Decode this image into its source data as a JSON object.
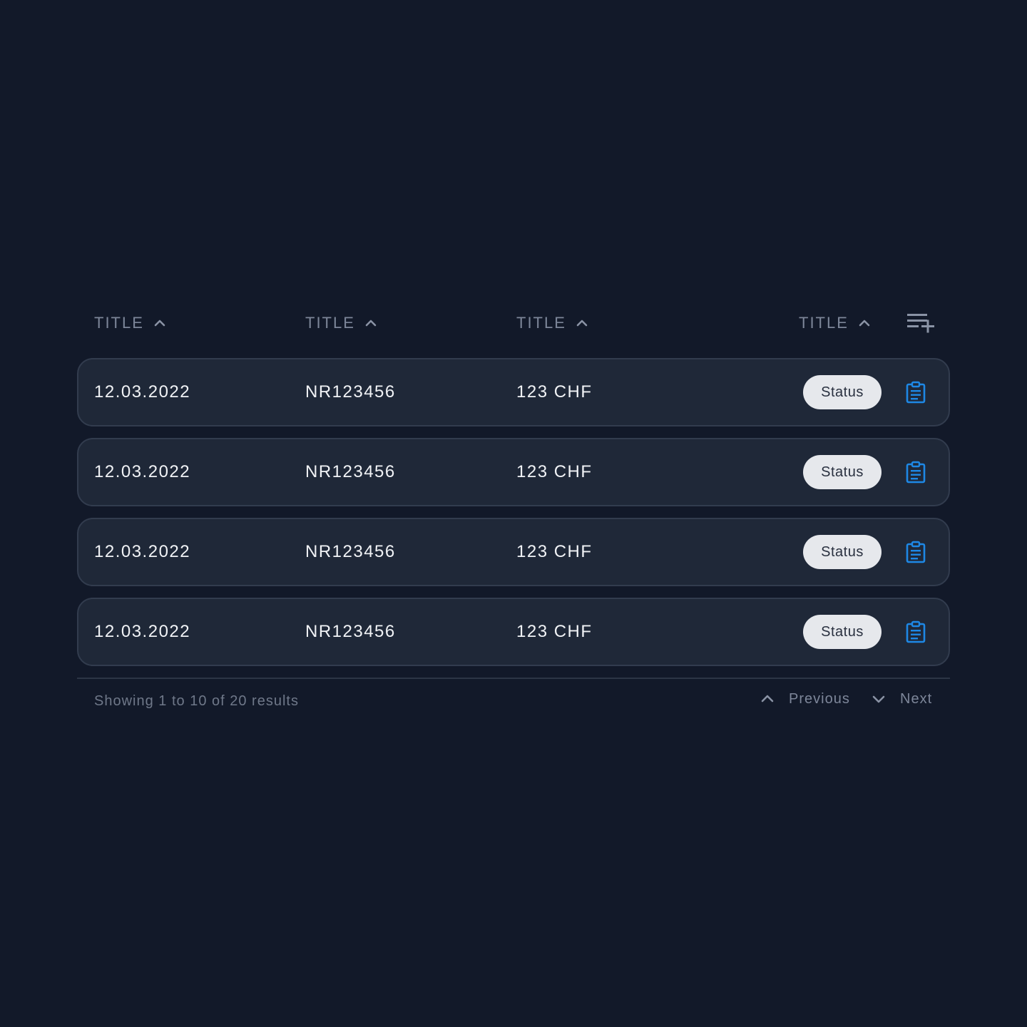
{
  "header": {
    "columns": [
      {
        "label": "TITLE",
        "sort_icon": "chevron-up-icon"
      },
      {
        "label": "TITLE",
        "sort_icon": "chevron-up-icon"
      },
      {
        "label": "TITLE",
        "sort_icon": "chevron-up-icon"
      },
      {
        "label": "TITLE",
        "sort_icon": "chevron-up-icon"
      }
    ],
    "add_column_icon": "playlist-add-icon"
  },
  "rows": [
    {
      "date": "12.03.2022",
      "number": "NR123456",
      "amount": "123 CHF",
      "status": "Status",
      "action_icon": "clipboard-icon"
    },
    {
      "date": "12.03.2022",
      "number": "NR123456",
      "amount": "123 CHF",
      "status": "Status",
      "action_icon": "clipboard-icon"
    },
    {
      "date": "12.03.2022",
      "number": "NR123456",
      "amount": "123 CHF",
      "status": "Status",
      "action_icon": "clipboard-icon"
    },
    {
      "date": "12.03.2022",
      "number": "NR123456",
      "amount": "123 CHF",
      "status": "Status",
      "action_icon": "clipboard-icon"
    }
  ],
  "footer": {
    "results_text": "Showing 1 to 10 of 20 results",
    "previous_label": "Previous",
    "next_label": "Next"
  },
  "colors": {
    "background": "#121929",
    "row_background": "#1f2838",
    "row_border": "#323c4e",
    "accent_icon": "#1e88e5",
    "badge_background": "#e6e8ec"
  }
}
